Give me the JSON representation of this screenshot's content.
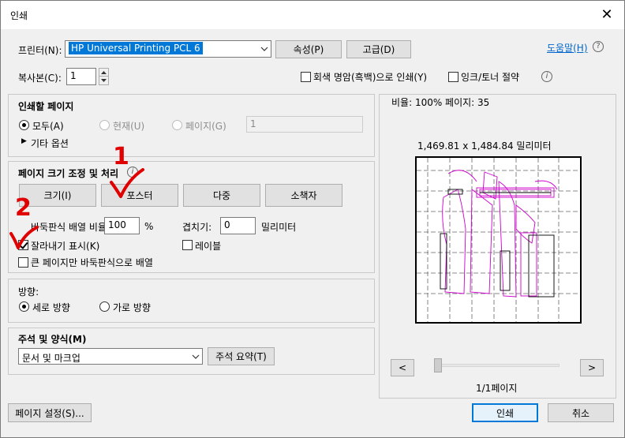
{
  "window": {
    "title": "인쇄",
    "close_glyph": "✕"
  },
  "printer": {
    "label": "프린터(N):",
    "value": "HP Universal Printing PCL 6",
    "properties_button": "속성(P)",
    "advanced_button": "고급(D)",
    "help_link": "도움말(H)",
    "help_icon": "?"
  },
  "copies": {
    "label": "복사본(C):",
    "value": "1",
    "grayscale_label": "회색 명암(흑백)으로 인쇄(Y)",
    "grayscale_checked": false,
    "ink_save_label": "잉크/토너 절약",
    "ink_save_checked": false,
    "info_icon": "i"
  },
  "pages_to_print": {
    "title": "인쇄할 페이지",
    "all_label": "모두(A)",
    "current_label": "현재(U)",
    "pages_label": "페이지(G)",
    "pages_value": "1",
    "more_options_label": "기타 옵션",
    "selected": "all"
  },
  "page_sizing": {
    "title": "페이지 크기 조정 및 처리",
    "info_icon": "i",
    "buttons": [
      "크기(I)",
      "포스터",
      "다중",
      "소책자"
    ],
    "tile_scale_label": "바둑판식 배열 비율:",
    "tile_scale_value": "100",
    "tile_scale_unit": "%",
    "overlap_label": "겹치기:",
    "overlap_value": "0",
    "overlap_unit": "밀리미터",
    "cut_marks_label": "잘라내기 표시(K)",
    "cut_marks_checked": true,
    "labels_label": "레이블",
    "labels_checked": false,
    "large_pages_label": "큰 페이지만 바둑판식으로 배열",
    "large_pages_checked": false
  },
  "orientation": {
    "title": "방향:",
    "portrait_label": "세로 방향",
    "landscape_label": "가로 방향",
    "selected": "portrait"
  },
  "comments": {
    "title": "주석 및 양식(M)",
    "value": "문서 및 마크업",
    "summary_button": "주석 요약(T)"
  },
  "preview": {
    "scale_text": "비율: 100% 페이지: 35",
    "dimensions": "1,469.81 x 1,484.84 밀리미터",
    "prev_glyph": "<",
    "next_glyph": ">",
    "page_indicator": "1/1페이지",
    "slider_position": 0
  },
  "footer": {
    "page_setup_button": "페이지 설정(S)...",
    "print_button": "인쇄",
    "cancel_button": "취소"
  },
  "annotations": {
    "marker_1": "1",
    "marker_2": "2"
  },
  "colors": {
    "accent": "#0078d7",
    "annotation": "#e00000",
    "preview_magenta": "#cc00cc"
  }
}
